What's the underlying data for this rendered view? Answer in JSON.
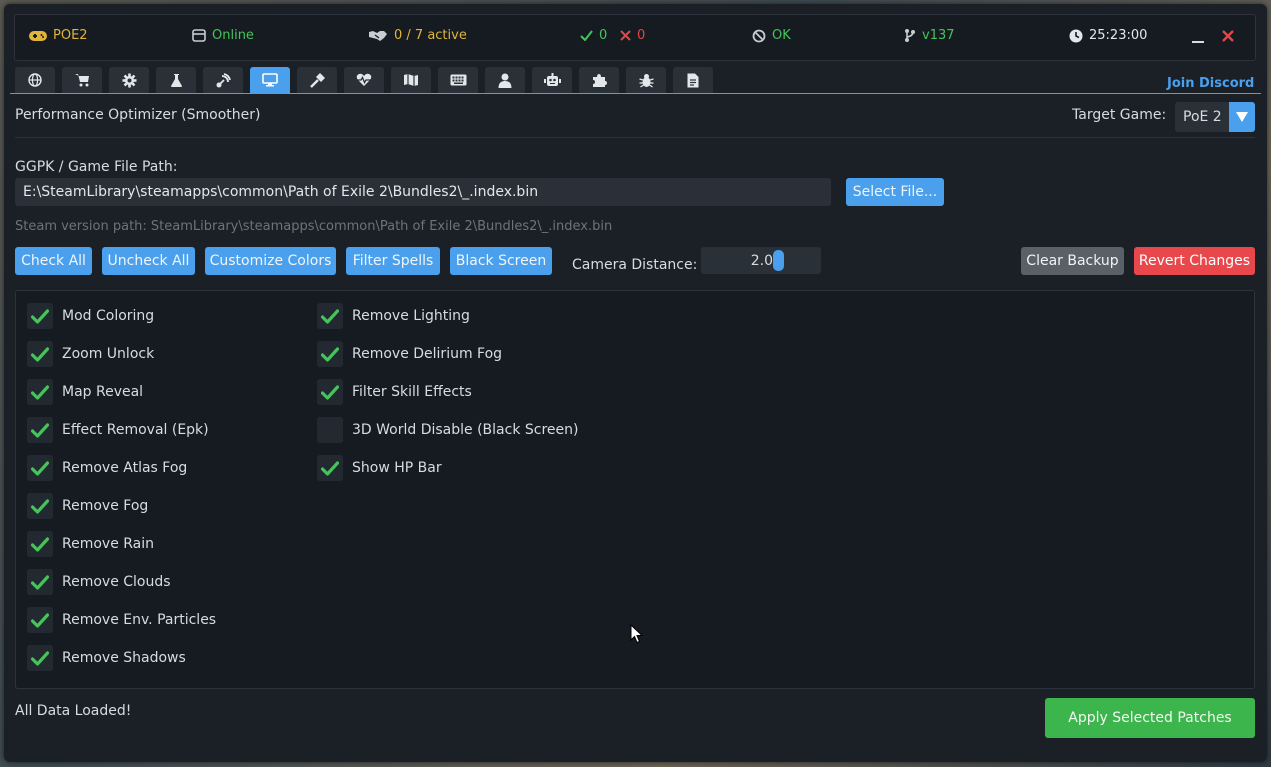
{
  "status": {
    "game": "POE2",
    "connection": "Online",
    "active": "0 / 7 active",
    "success_count": "0",
    "fail_count": "0",
    "health": "OK",
    "version": "v137",
    "clock": "25:23:00"
  },
  "tabs": [
    {
      "icon": "globe-icon"
    },
    {
      "icon": "cart-icon"
    },
    {
      "icon": "gear-icon"
    },
    {
      "icon": "flask-icon"
    },
    {
      "icon": "satellite-icon"
    },
    {
      "icon": "desktop-icon",
      "active": true
    },
    {
      "icon": "hammer-icon"
    },
    {
      "icon": "heart-pulse-icon"
    },
    {
      "icon": "map-icon"
    },
    {
      "icon": "keyboard-icon"
    },
    {
      "icon": "user-icon"
    },
    {
      "icon": "robot-icon"
    },
    {
      "icon": "puzzle-icon"
    },
    {
      "icon": "bug-icon"
    },
    {
      "icon": "document-icon"
    }
  ],
  "header": {
    "join_discord": "Join Discord",
    "title": "Performance Optimizer (Smoother)",
    "target_game_label": "Target Game:",
    "target_game_value": "PoE 2"
  },
  "file": {
    "label": "GGPK / Game File Path:",
    "path": "E:\\SteamLibrary\\steamapps\\common\\Path of Exile 2\\Bundles2\\_.index.bin",
    "select_button": "Select File...",
    "steam_hint": "Steam version path: SteamLibrary\\steamapps\\common\\Path of Exile 2\\Bundles2\\_.index.bin"
  },
  "actions": {
    "check_all": "Check All",
    "uncheck_all": "Uncheck All",
    "customize_colors": "Customize Colors",
    "filter_spells": "Filter Spells",
    "black_screen": "Black Screen",
    "camera_label": "Camera Distance:",
    "camera_value": "2.0",
    "clear_backup": "Clear Backup",
    "revert_changes": "Revert Changes"
  },
  "options_col1": [
    {
      "label": "Mod Coloring",
      "checked": true
    },
    {
      "label": "Zoom Unlock",
      "checked": true
    },
    {
      "label": "Map Reveal",
      "checked": true
    },
    {
      "label": "Effect Removal (Epk)",
      "checked": true
    },
    {
      "label": "Remove Atlas Fog",
      "checked": true
    },
    {
      "label": "Remove Fog",
      "checked": true
    },
    {
      "label": "Remove Rain",
      "checked": true
    },
    {
      "label": "Remove Clouds",
      "checked": true
    },
    {
      "label": "Remove Env. Particles",
      "checked": true
    },
    {
      "label": "Remove Shadows",
      "checked": true
    }
  ],
  "options_col2": [
    {
      "label": "Remove Lighting",
      "checked": true
    },
    {
      "label": "Remove Delirium Fog",
      "checked": true
    },
    {
      "label": "Filter Skill Effects",
      "checked": true
    },
    {
      "label": "3D World Disable (Black Screen)",
      "checked": false
    },
    {
      "label": "Show HP Bar",
      "checked": true
    }
  ],
  "footer": {
    "status_message": "All Data Loaded!",
    "apply_button": "Apply Selected Patches"
  },
  "colors": {
    "accent": "#4aa0ec",
    "success": "#46c35a",
    "danger": "#e8484c",
    "warning": "#e0b43a"
  }
}
